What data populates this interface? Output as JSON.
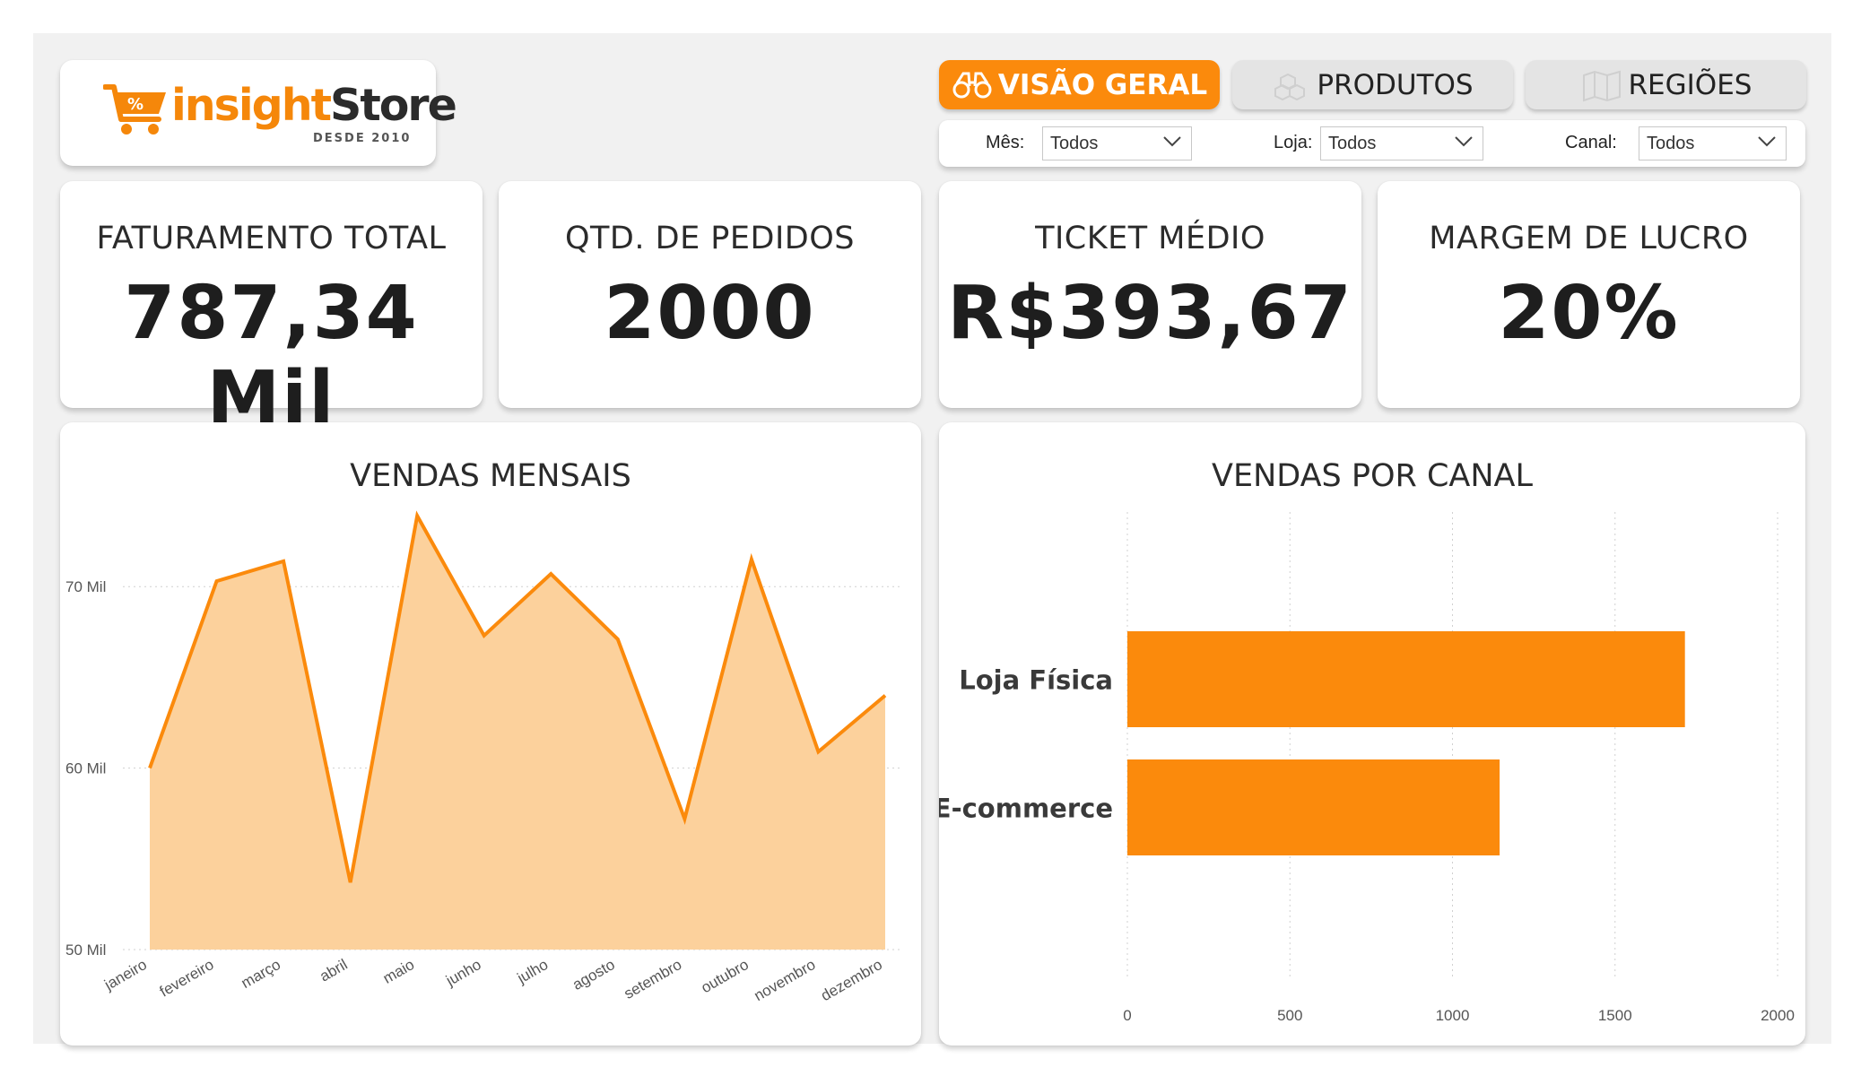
{
  "logo": {
    "brand_part1": "insight",
    "brand_part2": "Store",
    "tagline": "DESDE 2010"
  },
  "tabs": [
    {
      "label": "VISÃO GERAL",
      "active": true,
      "icon": "binoculars-icon"
    },
    {
      "label": "PRODUTOS",
      "active": false,
      "icon": "boxes-icon"
    },
    {
      "label": "REGIÕES",
      "active": false,
      "icon": "map-icon"
    }
  ],
  "filters": [
    {
      "label": "Mês:",
      "value": "Todos"
    },
    {
      "label": "Loja:",
      "value": "Todos"
    },
    {
      "label": "Canal:",
      "value": "Todos"
    }
  ],
  "kpis": [
    {
      "title": "FATURAMENTO TOTAL",
      "value": "787,34 Mil"
    },
    {
      "title": "QTD. DE PEDIDOS",
      "value": "2000"
    },
    {
      "title": "TICKET MÉDIO",
      "value": "R$393,67"
    },
    {
      "title": "MARGEM DE LUCRO",
      "value": "20%"
    }
  ],
  "colors": {
    "accent": "#fb8a0c",
    "area_fill": "#fcd19c",
    "bar": "#fb8a0c"
  },
  "chart_data": [
    {
      "type": "area",
      "title": "VENDAS MENSAIS",
      "categories": [
        "janeiro",
        "fevereiro",
        "março",
        "abril",
        "maio",
        "junho",
        "julho",
        "agosto",
        "setembro",
        "outubro",
        "novembro",
        "dezembro"
      ],
      "values": [
        60000,
        70300,
        71400,
        53700,
        73900,
        67300,
        70700,
        67100,
        57200,
        71500,
        60900,
        64000
      ],
      "ylim": [
        50000,
        75000
      ],
      "yticks": [
        50000,
        60000,
        70000
      ],
      "ytick_labels": [
        "50 Mil",
        "60 Mil",
        "70 Mil"
      ],
      "grid": true
    },
    {
      "type": "bar",
      "orientation": "horizontal",
      "title": "VENDAS POR CANAL",
      "categories": [
        "Loja Física",
        "E-commerce"
      ],
      "values": [
        1715,
        1145
      ],
      "xlim": [
        0,
        2000
      ],
      "xticks": [
        0,
        500,
        1000,
        1500,
        2000
      ],
      "xtick_labels": [
        "0",
        "500",
        "1000",
        "1500",
        "2000"
      ],
      "grid": true
    }
  ]
}
